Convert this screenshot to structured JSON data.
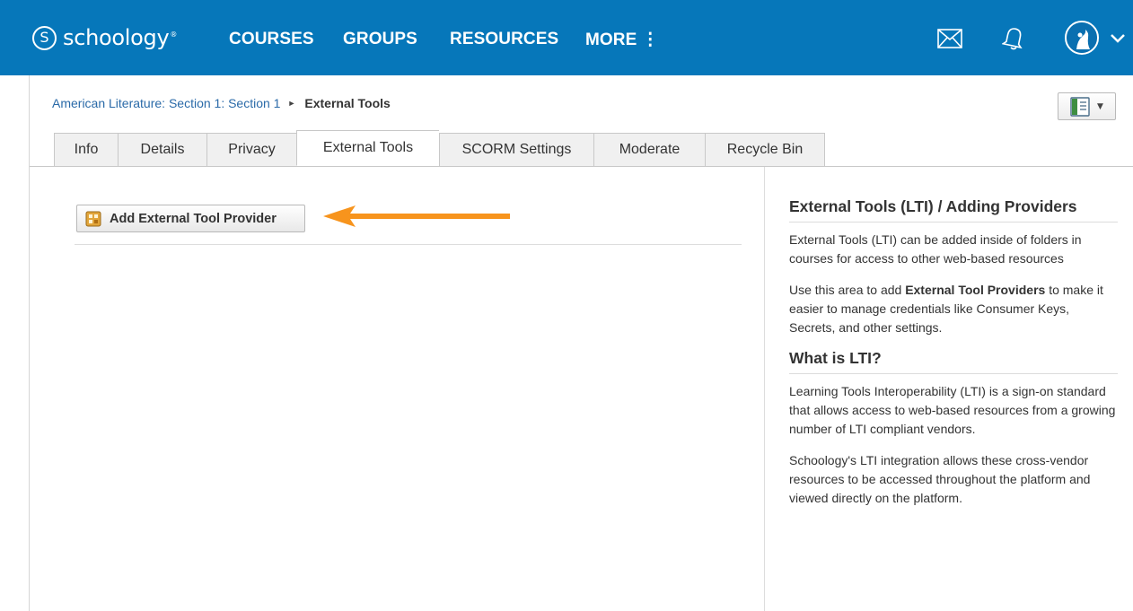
{
  "brand": {
    "mark": "S",
    "name": "schoology",
    "tm": "®",
    "accent_color": "#0677ba"
  },
  "nav": {
    "courses": "COURSES",
    "groups": "GROUPS",
    "resources": "RESOURCES",
    "more": "MORE ⋮"
  },
  "header_icons": [
    "mail-icon",
    "bell-icon",
    "avatar",
    "chevron-down-icon"
  ],
  "breadcrumb": {
    "parent": "American Literature: Section 1: Section 1",
    "separator": "►",
    "current": "External Tools"
  },
  "layout_button": {
    "icon": "layout-icon",
    "caret": "▼"
  },
  "tabs": [
    {
      "label": "Info",
      "active": false
    },
    {
      "label": "Details",
      "active": false
    },
    {
      "label": "Privacy",
      "active": false
    },
    {
      "label": "External Tools",
      "active": true
    },
    {
      "label": "SCORM Settings",
      "active": false
    },
    {
      "label": "Moderate",
      "active": false
    },
    {
      "label": "Recycle Bin",
      "active": false
    }
  ],
  "main": {
    "add_provider_label": "Add External Tool Provider",
    "arrow_color": "#f7941d"
  },
  "panel": {
    "heading1": "External Tools (LTI) / Adding Providers",
    "p1": "External Tools (LTI) can be added inside of folders in courses for access to other web-based resources",
    "p2_pre": "Use this area to add ",
    "p2_bold": "External Tool Providers",
    "p2_post": " to make it easier to manage credentials like Consumer Keys, Secrets, and other settings.",
    "heading2": "What is LTI?",
    "p3": "Learning Tools Interoperability (LTI) is a sign-on standard that allows access to web-based resources from a growing number of LTI compliant vendors.",
    "p4": "Schoology's LTI integration allows these cross-vendor resources to be accessed throughout the platform and viewed directly on the platform."
  }
}
